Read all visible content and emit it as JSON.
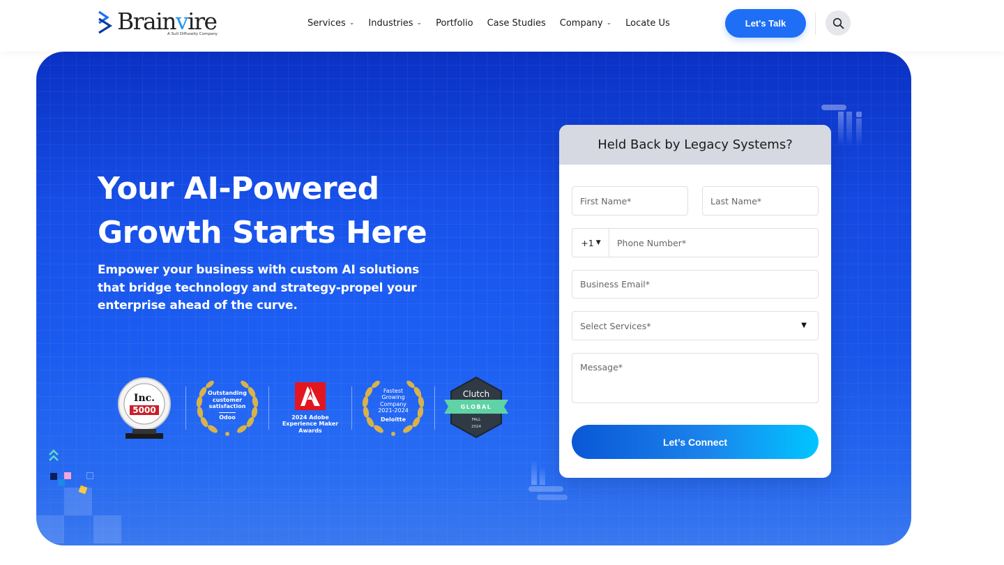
{
  "header": {
    "logo": {
      "word_start": "Brain",
      "word_v": "v",
      "word_end": "ire",
      "tagline": "A Sutl Diffuseity Company"
    },
    "nav": [
      {
        "label": "Services",
        "has_dropdown": true
      },
      {
        "label": "Industries",
        "has_dropdown": true
      },
      {
        "label": "Portfolio",
        "has_dropdown": false
      },
      {
        "label": "Case Studies",
        "has_dropdown": false
      },
      {
        "label": "Company",
        "has_dropdown": true
      },
      {
        "label": "Locate Us",
        "has_dropdown": false
      }
    ],
    "caret": "⌄",
    "cta_label": "Let's Talk",
    "search_icon": "search-icon"
  },
  "hero": {
    "title": "Your AI-Powered Growth Starts Here",
    "subtitle": "Empower your business with custom AI solutions that bridge technology and strategy-propel your enterprise ahead of the curve.",
    "awards": [
      {
        "icon": "inc-5000-badge-icon",
        "line1": "Inc.",
        "line2": "5000"
      },
      {
        "icon": "laurel-wreath-icon",
        "text": "Outstanding customer satisfaction",
        "sub": "Odoo"
      },
      {
        "icon": "adobe-logo-icon",
        "text": "2024 Adobe Experience Maker Awards"
      },
      {
        "icon": "laurel-wreath-icon",
        "text": "Fastest Growing Company 2021-2024",
        "sub": "Deloitte"
      },
      {
        "icon": "clutch-badge-icon",
        "title": "Clutch",
        "ribbon": "GLOBAL",
        "season": "FALL",
        "year": "2024"
      }
    ]
  },
  "form": {
    "heading": "Held Back by Legacy Systems?",
    "first_name_placeholder": "First Name*",
    "last_name_placeholder": "Last Name*",
    "country_code": "+1",
    "phone_placeholder": "Phone Number*",
    "email_placeholder": "Business Email*",
    "services_placeholder": "Select Services*",
    "message_placeholder": "Message*",
    "submit_label": "Let’s Connect"
  },
  "colors": {
    "primary_blue": "#1e6ff5",
    "hero_top": "#0a34c6",
    "hero_bottom": "#4a93ff",
    "form_header": "#d6d9e2",
    "gold": "#d9b24a"
  }
}
